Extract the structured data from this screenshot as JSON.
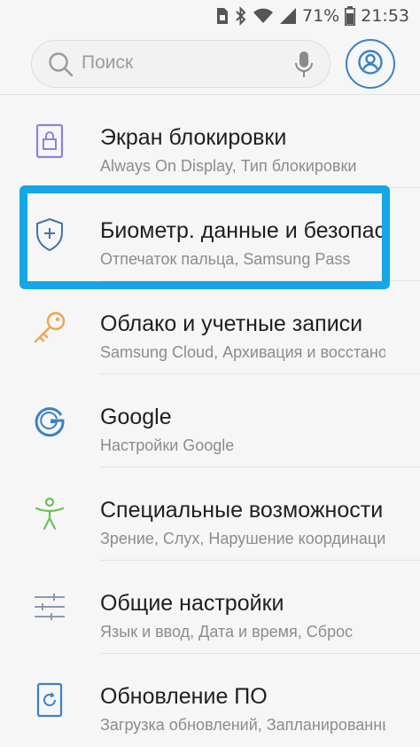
{
  "status_bar": {
    "battery_percent": "71%",
    "time": "21:53",
    "icons": [
      "sim-icon",
      "bluetooth-icon",
      "wifi-icon",
      "signal-icon",
      "battery-icon"
    ]
  },
  "search": {
    "placeholder": "Поиск"
  },
  "settings": {
    "items": [
      {
        "title": "Экран блокировки",
        "subtitle": "Always On Display, Тип блокировки",
        "icon": "lock-screen-icon"
      },
      {
        "title": "Биометр. данные и безопасность",
        "subtitle": "Отпечаток пальца, Samsung Pass",
        "icon": "shield-icon"
      },
      {
        "title": "Облако и учетные записи",
        "subtitle": "Samsung Cloud, Архивация и восстановление",
        "icon": "key-icon"
      },
      {
        "title": "Google",
        "subtitle": "Настройки Google",
        "icon": "google-icon"
      },
      {
        "title": "Специальные возможности",
        "subtitle": "Зрение, Слух, Нарушение координации",
        "icon": "accessibility-icon"
      },
      {
        "title": "Общие настройки",
        "subtitle": "Язык и ввод, Дата и время, Сброс",
        "icon": "sliders-icon"
      },
      {
        "title": "Обновление ПО",
        "subtitle": "Загрузка обновлений, Запланированные",
        "icon": "software-update-icon"
      }
    ]
  },
  "colors": {
    "highlight": "#14a6e6",
    "accent_blue": "#3a82c4",
    "lock_purple": "#8f82d6",
    "key_orange": "#f0a24f",
    "accessibility_green": "#6cbf58"
  }
}
